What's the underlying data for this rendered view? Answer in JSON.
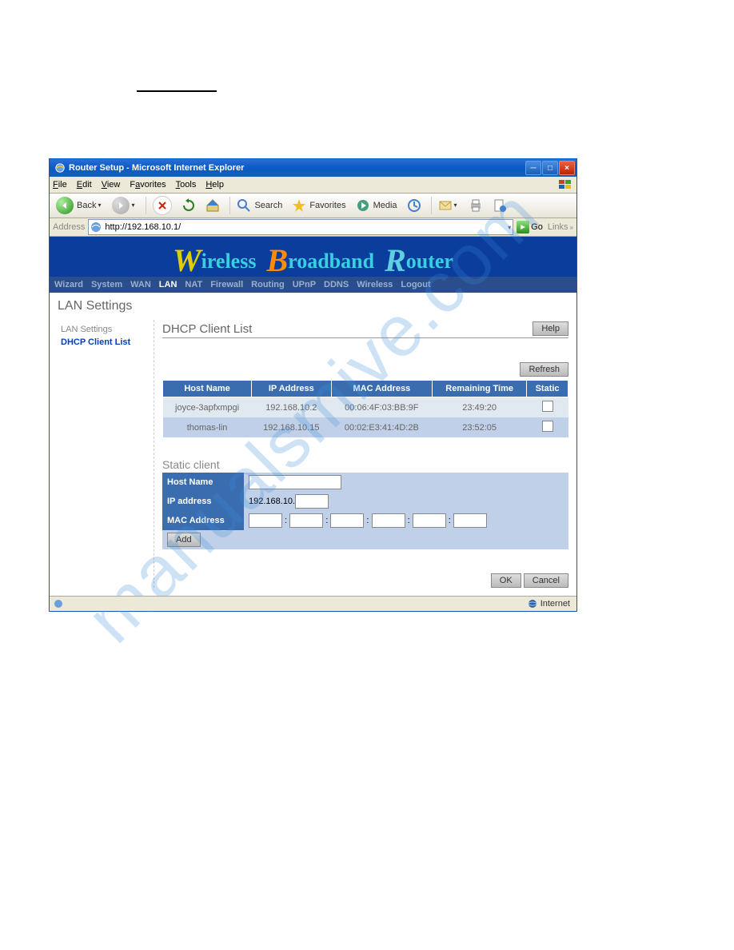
{
  "window": {
    "title": "Router Setup - Microsoft Internet Explorer"
  },
  "menubar": {
    "file": "File",
    "edit": "Edit",
    "view": "View",
    "favorites": "Favorites",
    "tools": "Tools",
    "help": "Help"
  },
  "toolbar": {
    "back": "Back",
    "search": "Search",
    "favorites": "Favorites",
    "media": "Media"
  },
  "addressbar": {
    "label": "Address",
    "url": "http://192.168.10.1/",
    "go": "Go",
    "links": "Links"
  },
  "banner": {
    "w": "W",
    "wrest": "ireless",
    "b": "B",
    "brest": "roadband",
    "r": "R",
    "rrest": "outer"
  },
  "nav": [
    "Wizard",
    "System",
    "WAN",
    "LAN",
    "NAT",
    "Firewall",
    "Routing",
    "UPnP",
    "DDNS",
    "Wireless",
    "Logout"
  ],
  "nav_active": "LAN",
  "page_title": "LAN Settings",
  "sidebar": {
    "lan": "LAN Settings",
    "dhcp": "DHCP Client List"
  },
  "section": {
    "title": "DHCP Client List",
    "help_btn": "Help",
    "refresh_btn": "Refresh"
  },
  "table": {
    "headers": [
      "Host Name",
      "IP Address",
      "MAC Address",
      "Remaining Time",
      "Static"
    ],
    "rows": [
      {
        "host": "joyce-3apfxmpgi",
        "ip": "192.168.10.2",
        "mac": "00:06:4F:03:BB:9F",
        "time": "23:49:20"
      },
      {
        "host": "thomas-lin",
        "ip": "192.168.10.15",
        "mac": "00:02:E3:41:4D:2B",
        "time": "23:52:05"
      }
    ]
  },
  "static_form": {
    "title": "Static client",
    "host_label": "Host Name",
    "ip_label": "IP address",
    "ip_prefix": "192.168.10.",
    "mac_label": "MAC Address",
    "add_btn": "Add"
  },
  "actions": {
    "ok": "OK",
    "cancel": "Cancel"
  },
  "statusbar": {
    "zone": "Internet"
  },
  "watermark": "manualsmive.com"
}
